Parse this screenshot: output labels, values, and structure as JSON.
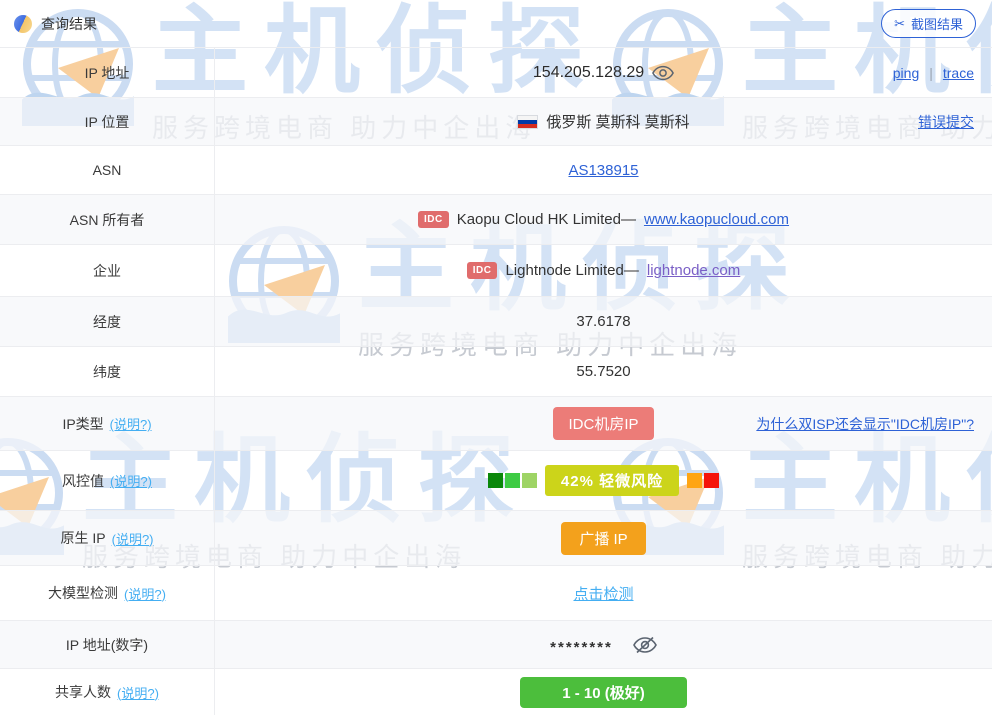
{
  "header": {
    "title": "查询结果",
    "screenshot_button": "截图结果",
    "scissors_glyph": "✂"
  },
  "watermark": {
    "brand": "主机侦探",
    "tagline": "服务跨境电商 助力中企出海"
  },
  "rows": {
    "ip": {
      "label": "IP 地址",
      "value": "154.205.128.29",
      "ping": "ping",
      "divider": "|",
      "trace": "trace"
    },
    "location": {
      "label": "IP 位置",
      "value": "俄罗斯 莫斯科 莫斯科",
      "right_link": "错误提交"
    },
    "asn": {
      "label": "ASN",
      "value": "AS138915"
    },
    "asn_owner": {
      "label": "ASN 所有者",
      "badge": "IDC",
      "value": "Kaopu Cloud HK Limited—",
      "link": "www.kaopucloud.com"
    },
    "company": {
      "label": "企业",
      "badge": "IDC",
      "value": "Lightnode Limited—",
      "link": "lightnode.com"
    },
    "longitude": {
      "label": "经度",
      "value": "37.6178"
    },
    "latitude": {
      "label": "纬度",
      "value": "55.7520"
    },
    "ip_type": {
      "label": "IP类型",
      "help": "(说明?)",
      "badge": "IDC机房IP",
      "right_link": "为什么双ISP还会显示\"IDC机房IP\"?"
    },
    "risk": {
      "label": "风控值",
      "help": "(说明?)",
      "badge": "42%  轻微风险"
    },
    "native_ip": {
      "label": "原生 IP",
      "help": "(说明?)",
      "badge": "广播 IP"
    },
    "llm_check": {
      "label": "大模型检测",
      "help": "(说明?)",
      "link": "点击检测"
    },
    "ip_number": {
      "label": "IP 地址(数字)",
      "value": "********"
    },
    "shared": {
      "label": "共享人数",
      "help": "(说明?)",
      "badge": "1 - 10 (极好)"
    }
  },
  "colors": {
    "link_blue": "#2e62d6",
    "link_purple": "#7a5fc6",
    "link_sky": "#44aef2",
    "badge_red": "#ec7c78",
    "badge_orange": "#f3a11c",
    "badge_yellow": "#ccd41a",
    "badge_green": "#4cbe3c",
    "risk_green_dark": "#0a870a",
    "risk_green_mid": "#3ecb44",
    "risk_green_light": "#9ed465",
    "risk_orange": "#ffa514",
    "risk_red": "#f5140a"
  }
}
